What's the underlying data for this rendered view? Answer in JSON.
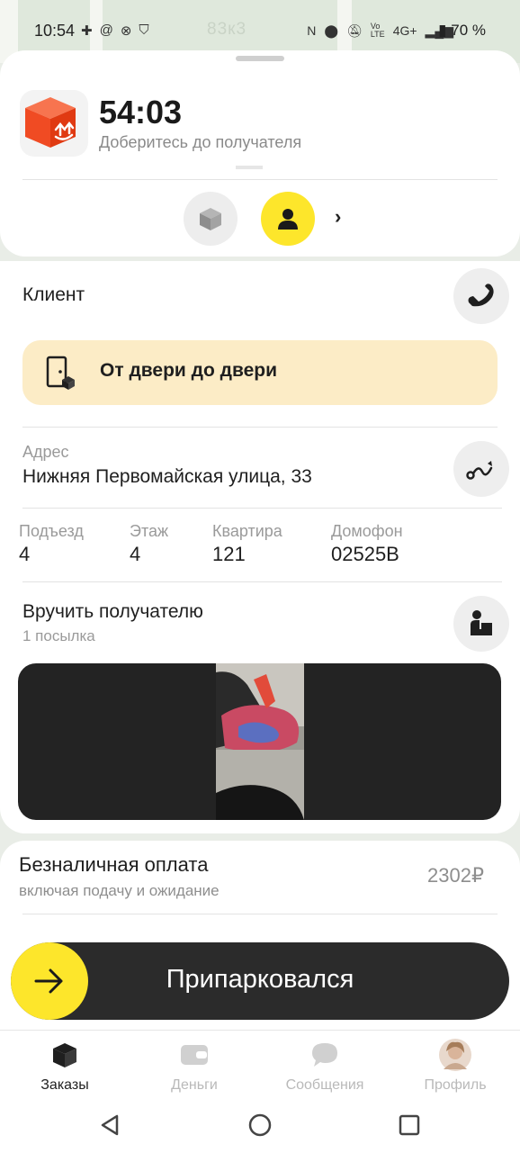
{
  "status_bar": {
    "time": "10:54",
    "map_label": "83к3",
    "network": "4G+",
    "battery": "70 %"
  },
  "order": {
    "timer": "54:03",
    "subtitle": "Доберитесь до получателя"
  },
  "client": {
    "title": "Клиент",
    "service_label": "От двери до двери"
  },
  "address": {
    "caption": "Адрес",
    "value": "Нижняя Первомайская улица, 33"
  },
  "details": [
    {
      "caption": "Подъезд",
      "value": "4"
    },
    {
      "caption": "Этаж",
      "value": "4"
    },
    {
      "caption": "Квартира",
      "value": "121"
    },
    {
      "caption": "Домофон",
      "value": "02525В"
    }
  ],
  "handover": {
    "title": "Вручить получателю",
    "subtitle": "1 посылка"
  },
  "payment": {
    "title": "Безналичная оплата",
    "subtitle": "включая подачу и ожидание",
    "amount": "2302₽"
  },
  "action": {
    "label": "Припарковался"
  },
  "bottom_nav": [
    {
      "label": "Заказы",
      "icon": "box-icon",
      "active": true
    },
    {
      "label": "Деньги",
      "icon": "wallet-icon",
      "active": false
    },
    {
      "label": "Сообщения",
      "icon": "chat-icon",
      "active": false
    },
    {
      "label": "Профиль",
      "icon": "avatar-icon",
      "active": false
    }
  ],
  "colors": {
    "accent_yellow": "#fde62b",
    "door_card_bg": "#fcecc6",
    "order_icon_red": "#f04b23",
    "slider_bg": "#2b2b2b"
  }
}
